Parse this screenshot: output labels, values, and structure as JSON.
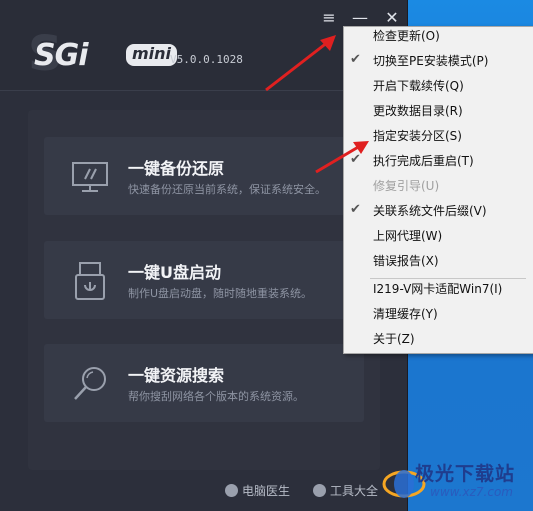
{
  "app": {
    "logo": "SGi",
    "logo_badge": "mini",
    "version": "V5.0.0.1028",
    "window_buttons": {
      "menu": "≡",
      "minimize": "—",
      "close": "✕"
    }
  },
  "cards": [
    {
      "title": "一键备份还原",
      "desc": "快速备份还原当前系统，保证系统安全。",
      "icon": "monitor-icon"
    },
    {
      "title": "一键U盘启动",
      "desc": "制作U盘启动盘，随时随地重装系统。",
      "icon": "usb-drive-icon"
    },
    {
      "title": "一键资源搜索",
      "desc": "帮你搜刮网络各个版本的系统资源。",
      "icon": "search-icon"
    }
  ],
  "footer": {
    "doctor": "电脑医生",
    "tools": "工具大全"
  },
  "context_menu": [
    {
      "label": "检查更新(O)",
      "checked": false,
      "disabled": false
    },
    {
      "label": "切换至PE安装模式(P)",
      "checked": true,
      "disabled": false
    },
    {
      "label": "开启下载续传(Q)",
      "checked": false,
      "disabled": false
    },
    {
      "label": "更改数据目录(R)",
      "checked": false,
      "disabled": false
    },
    {
      "label": "指定安装分区(S)",
      "checked": false,
      "disabled": false
    },
    {
      "label": "执行完成后重启(T)",
      "checked": true,
      "disabled": false
    },
    {
      "label": "修复引导(U)",
      "checked": false,
      "disabled": true
    },
    {
      "label": "关联系统文件后缀(V)",
      "checked": true,
      "disabled": false
    },
    {
      "label": "上网代理(W)",
      "checked": false,
      "disabled": false
    },
    {
      "label": "错误报告(X)",
      "checked": false,
      "disabled": false
    },
    {
      "label": "I219-V网卡适配Win7(I)",
      "checked": false,
      "disabled": false
    },
    {
      "label": "清理缓存(Y)",
      "checked": false,
      "disabled": false
    },
    {
      "label": "关于(Z)",
      "checked": false,
      "disabled": false
    }
  ],
  "check_glyph": "✔",
  "watermark": {
    "name": "极光下载站",
    "url": "www.xz7.com"
  },
  "colors": {
    "arrow": "#e02020",
    "accent": "#1f7fd6"
  }
}
